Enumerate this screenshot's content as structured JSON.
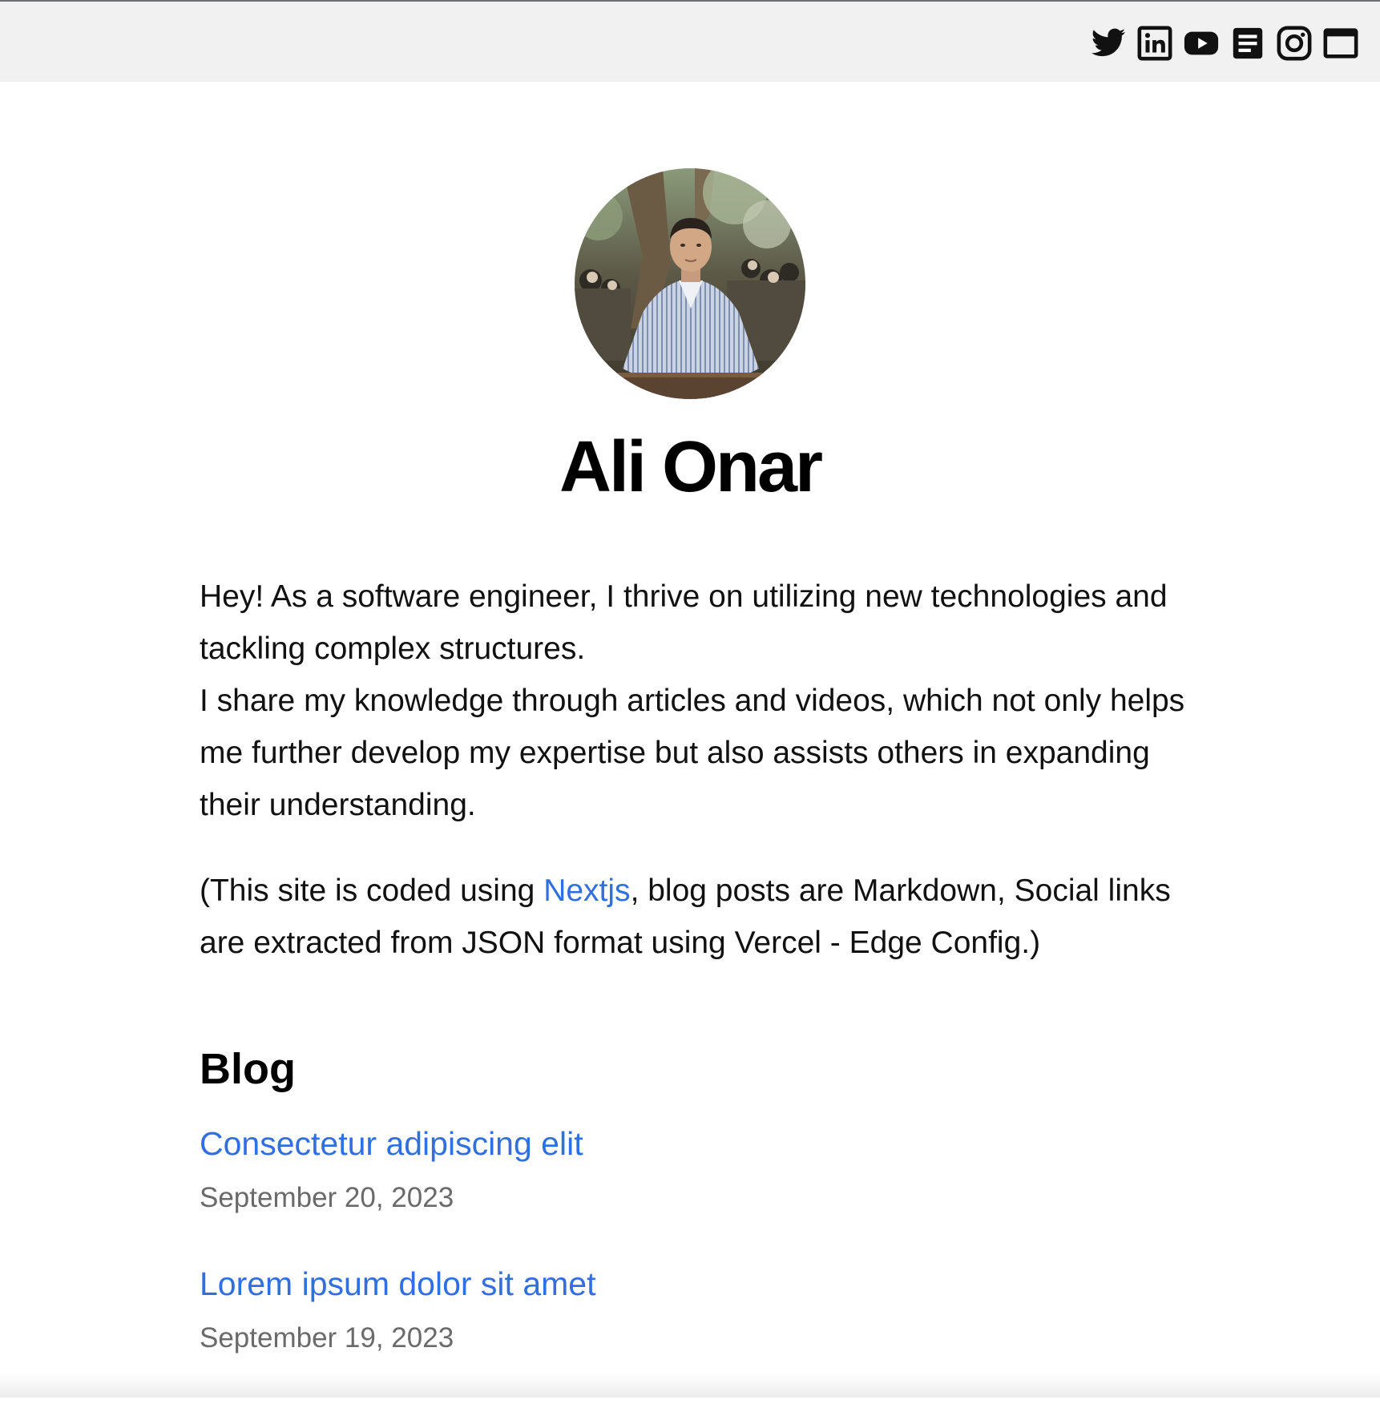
{
  "header": {
    "social_links": [
      {
        "icon": "twitter-icon",
        "label": "Twitter"
      },
      {
        "icon": "linkedin-icon",
        "label": "LinkedIn"
      },
      {
        "icon": "youtube-icon",
        "label": "YouTube"
      },
      {
        "icon": "medium-icon",
        "label": "Articles"
      },
      {
        "icon": "instagram-icon",
        "label": "Instagram"
      },
      {
        "icon": "window-icon",
        "label": "Website"
      }
    ]
  },
  "profile": {
    "name": "Ali Onar",
    "avatar_alt": "profile photo"
  },
  "bio": {
    "line1": "Hey! As a software engineer, I thrive on utilizing new technologies and tackling complex structures.",
    "line2": "I share my knowledge through articles and videos, which not only helps me further develop my expertise but also assists others in expanding their understanding.",
    "note_prefix": "(This site is coded using ",
    "note_link": "Nextjs",
    "note_suffix": ", blog posts are Markdown, Social links are extracted from JSON format using Vercel - Edge Config.)"
  },
  "blog": {
    "heading": "Blog",
    "posts": [
      {
        "title": "Consectetur adipiscing elit",
        "date": "September 20, 2023"
      },
      {
        "title": "Lorem ipsum dolor sit amet",
        "date": "September 19, 2023"
      }
    ]
  },
  "colors": {
    "link": "#2f6fe0",
    "header_bg": "#f2f1f1",
    "date": "#6a6a6a"
  }
}
